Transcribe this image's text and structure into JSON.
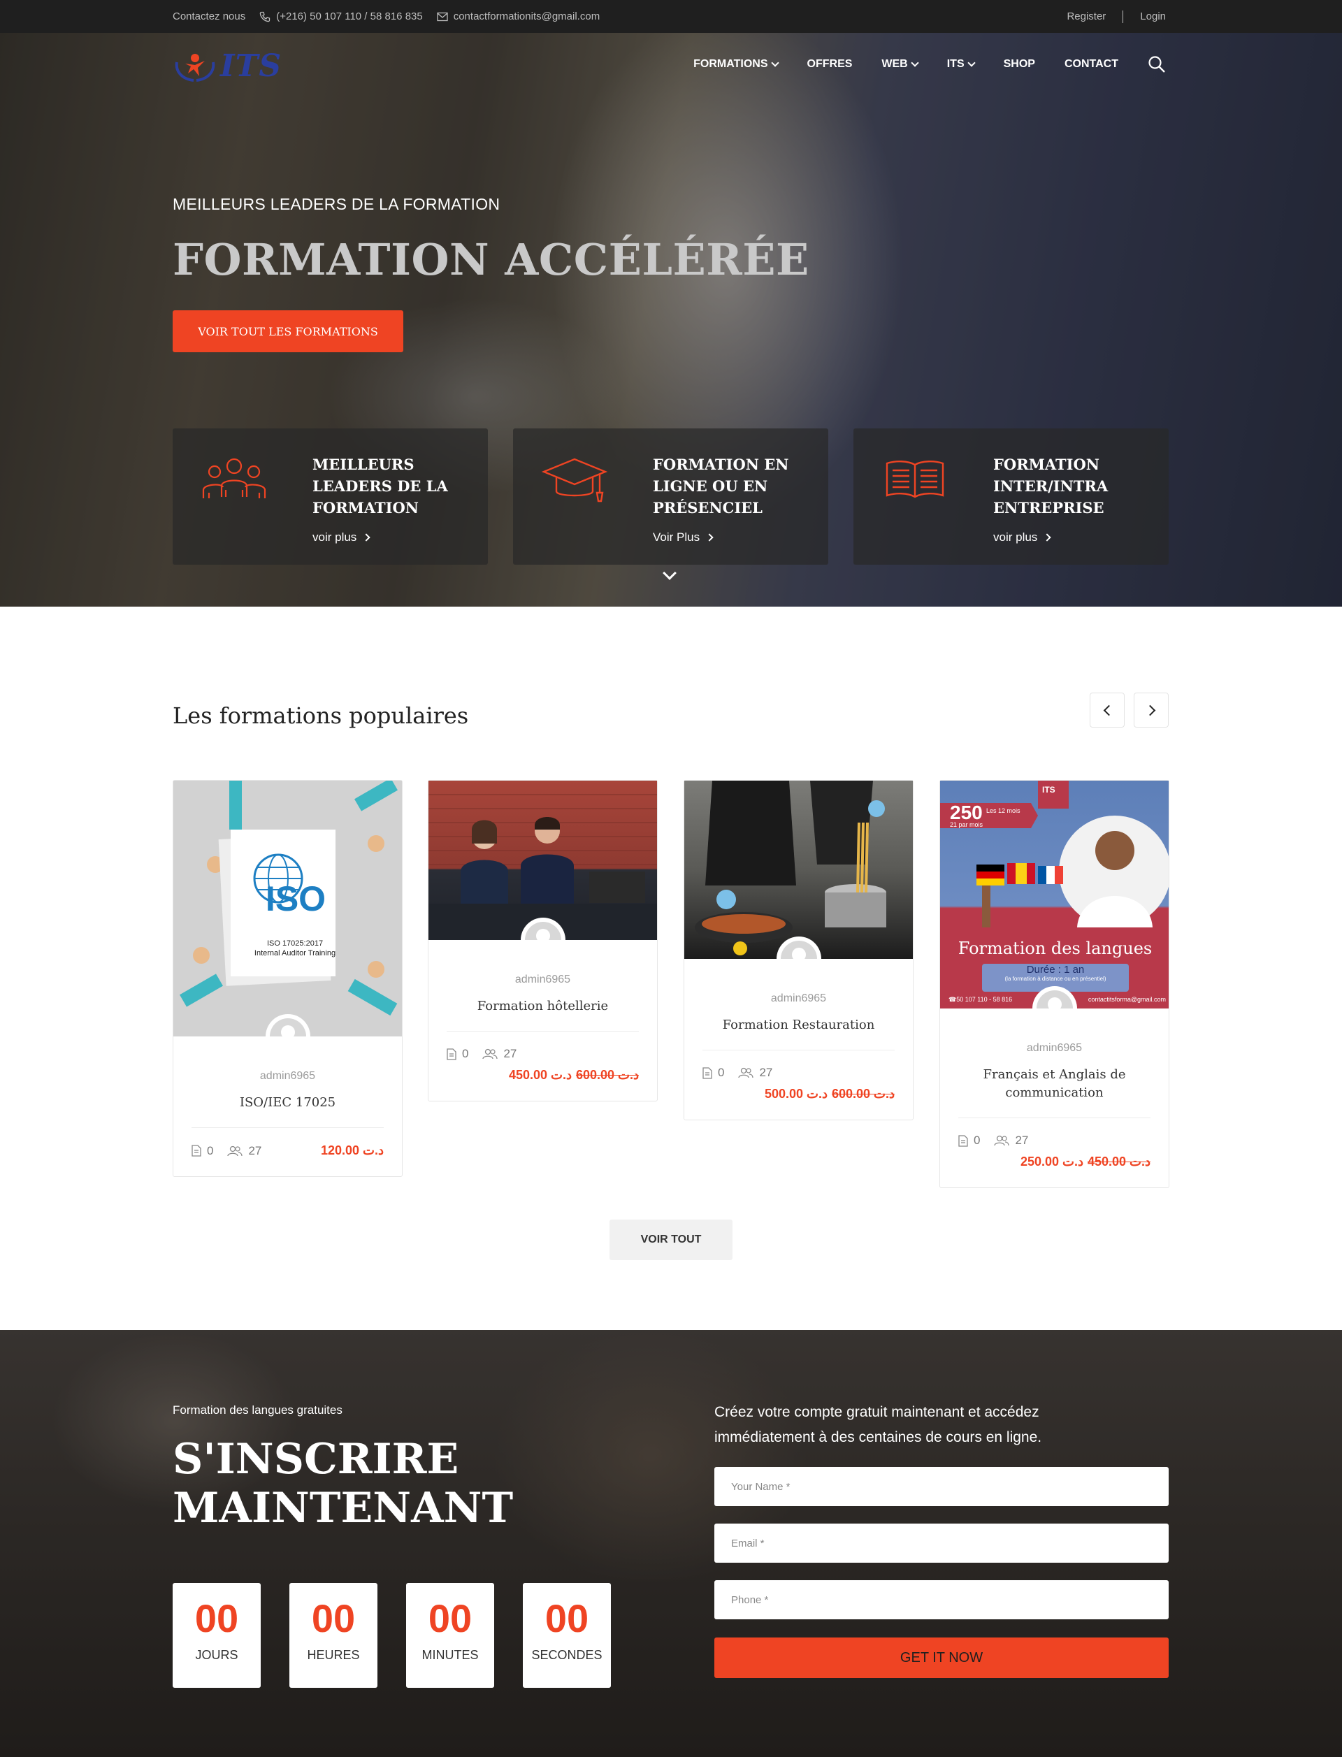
{
  "topbar": {
    "contact_label": "Contactez nous",
    "phone": "(+216) 50 107 110 / 58 816 835",
    "email": "contactformationits@gmail.com",
    "register": "Register",
    "login": "Login"
  },
  "header": {
    "logo_text": "ITS",
    "nav": [
      {
        "label": "FORMATIONS"
      },
      {
        "label": "OFFRES"
      },
      {
        "label": "WEB"
      },
      {
        "label": "ITS"
      },
      {
        "label": "SHOP"
      },
      {
        "label": "CONTACT"
      }
    ]
  },
  "hero": {
    "subtitle": "MEILLEURS LEADERS DE LA FORMATION",
    "title": "FORMATION ACCÉLÉRÉE",
    "button": "VOIR TOUT LES FORMATIONS",
    "features": [
      {
        "title": "MEILLEURS LEADERS DE LA FORMATION",
        "link": "voir plus",
        "icon": "team-icon"
      },
      {
        "title": "FORMATION EN LIGNE OU EN PRÉSENCIEL",
        "link": "Voir Plus",
        "icon": "graduation-cap-icon"
      },
      {
        "title": "FORMATION INTER/INTRA ENTREPRISE",
        "link": "voir plus",
        "icon": "open-book-icon"
      }
    ]
  },
  "popular": {
    "title": "Les formations populaires",
    "courses": [
      {
        "author": "admin6965",
        "title": "ISO/IEC 17025",
        "lessons": "0",
        "students": "27",
        "price": "120.00 د.ت",
        "old_price": "",
        "image_text": {
          "logo": "ISO",
          "line1": "ISO 17025:2017",
          "line2": "Internal Auditor Training"
        }
      },
      {
        "author": "admin6965",
        "title": "Formation hôtellerie",
        "lessons": "0",
        "students": "27",
        "price": "450.00 د.ت",
        "old_price": "600.00 د.ت"
      },
      {
        "author": "admin6965",
        "title": "Formation Restauration",
        "lessons": "0",
        "students": "27",
        "price": "500.00 د.ت",
        "old_price": "600.00 د.ت"
      },
      {
        "author": "admin6965",
        "title": "Français et Anglais de communication",
        "lessons": "0",
        "students": "27",
        "price": "250.00 د.ت",
        "old_price": "450.00 د.ت",
        "image_text": {
          "badge": "ITS",
          "promo": "250",
          "promo_sub1": "Les 12 mois",
          "promo_sub2": "21 par mois",
          "headline": "Formation des langues",
          "duration": "Durée : 1 an",
          "duration_note": "(la formation à distance ou en présentiel)",
          "footer_left": "☎50 107 110 - 58 816",
          "footer_right": "contactitsforma@gmail.com"
        }
      }
    ],
    "voir_tout": "VOIR TOUT"
  },
  "signup": {
    "small": "Formation des langues gratuites",
    "title": "S'INSCRIRE MAINTENANT",
    "countdown": [
      {
        "value": "00",
        "label": "JOURS"
      },
      {
        "value": "00",
        "label": "HEURES"
      },
      {
        "value": "00",
        "label": "MINUTES"
      },
      {
        "value": "00",
        "label": "SECONDES"
      }
    ],
    "description": "Créez votre compte gratuit maintenant et accédez immédiatement à des centaines de cours en ligne.",
    "name_placeholder": "Your Name *",
    "email_placeholder": "Email *",
    "phone_placeholder": "Phone *",
    "button": "GET IT NOW"
  },
  "colors": {
    "accent": "#ef4423",
    "logo_blue": "#2a3e9e",
    "topbar": "#1f1f1f"
  }
}
